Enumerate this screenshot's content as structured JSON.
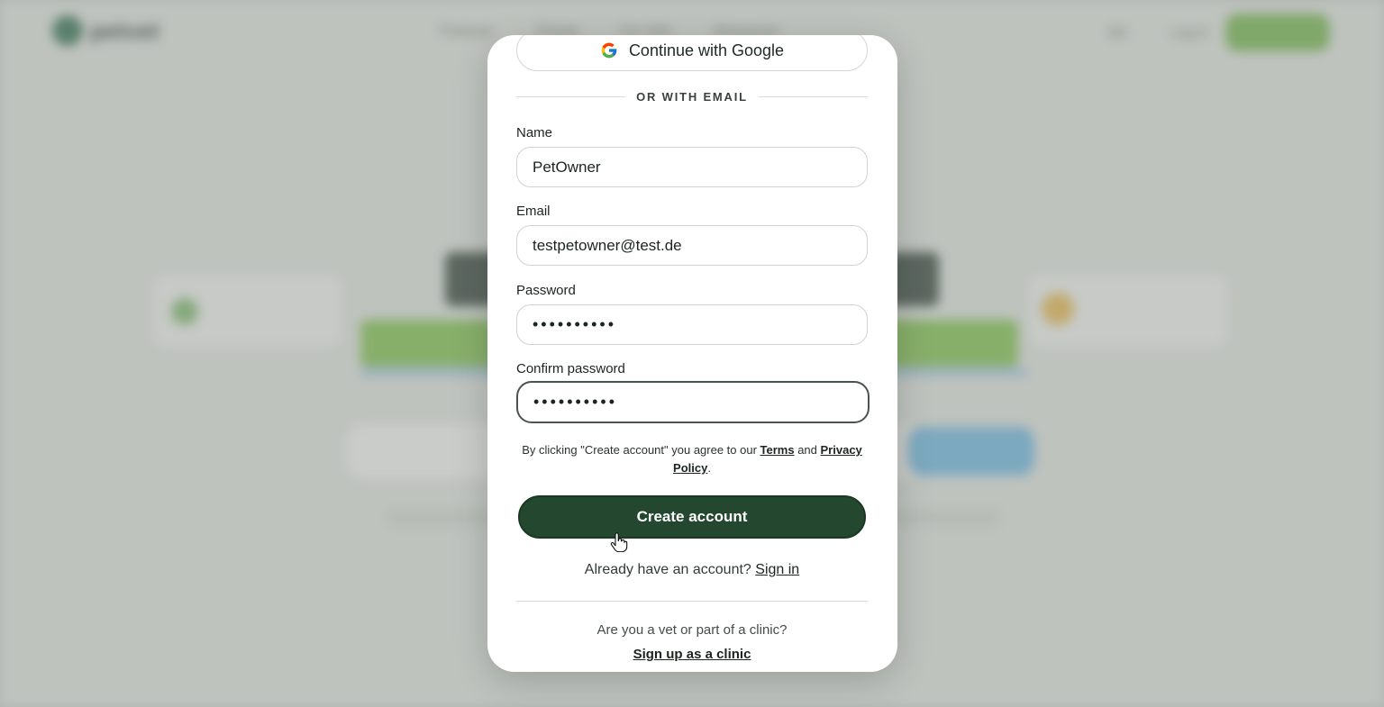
{
  "background": {
    "logo_text": "petvet",
    "nav": [
      "Features",
      "Pricing",
      "For Vets",
      "Resources"
    ],
    "lang": "EN",
    "login": "Log in"
  },
  "modal": {
    "google_button": "Continue with Google",
    "divider": "OR WITH EMAIL",
    "fields": {
      "name": {
        "label": "Name",
        "value": "PetOwner"
      },
      "email": {
        "label": "Email",
        "value": "testpetowner@test.de"
      },
      "password": {
        "label": "Password",
        "value": "••••••••••"
      },
      "confirm": {
        "label": "Confirm password",
        "value": "••••••••••"
      }
    },
    "terms": {
      "prefix": "By clicking \"Create account\" you agree to our ",
      "terms_link": "Terms",
      "and": " and ",
      "privacy_link": "Privacy Policy",
      "suffix": "."
    },
    "create_button": "Create account",
    "signin_prompt": "Already have an account? ",
    "signin_link": "Sign in",
    "vet_question": "Are you a vet or part of a clinic?",
    "vet_link": "Sign up as a clinic"
  },
  "colors": {
    "primary": "#23482f",
    "accent_green": "#6fb347"
  }
}
